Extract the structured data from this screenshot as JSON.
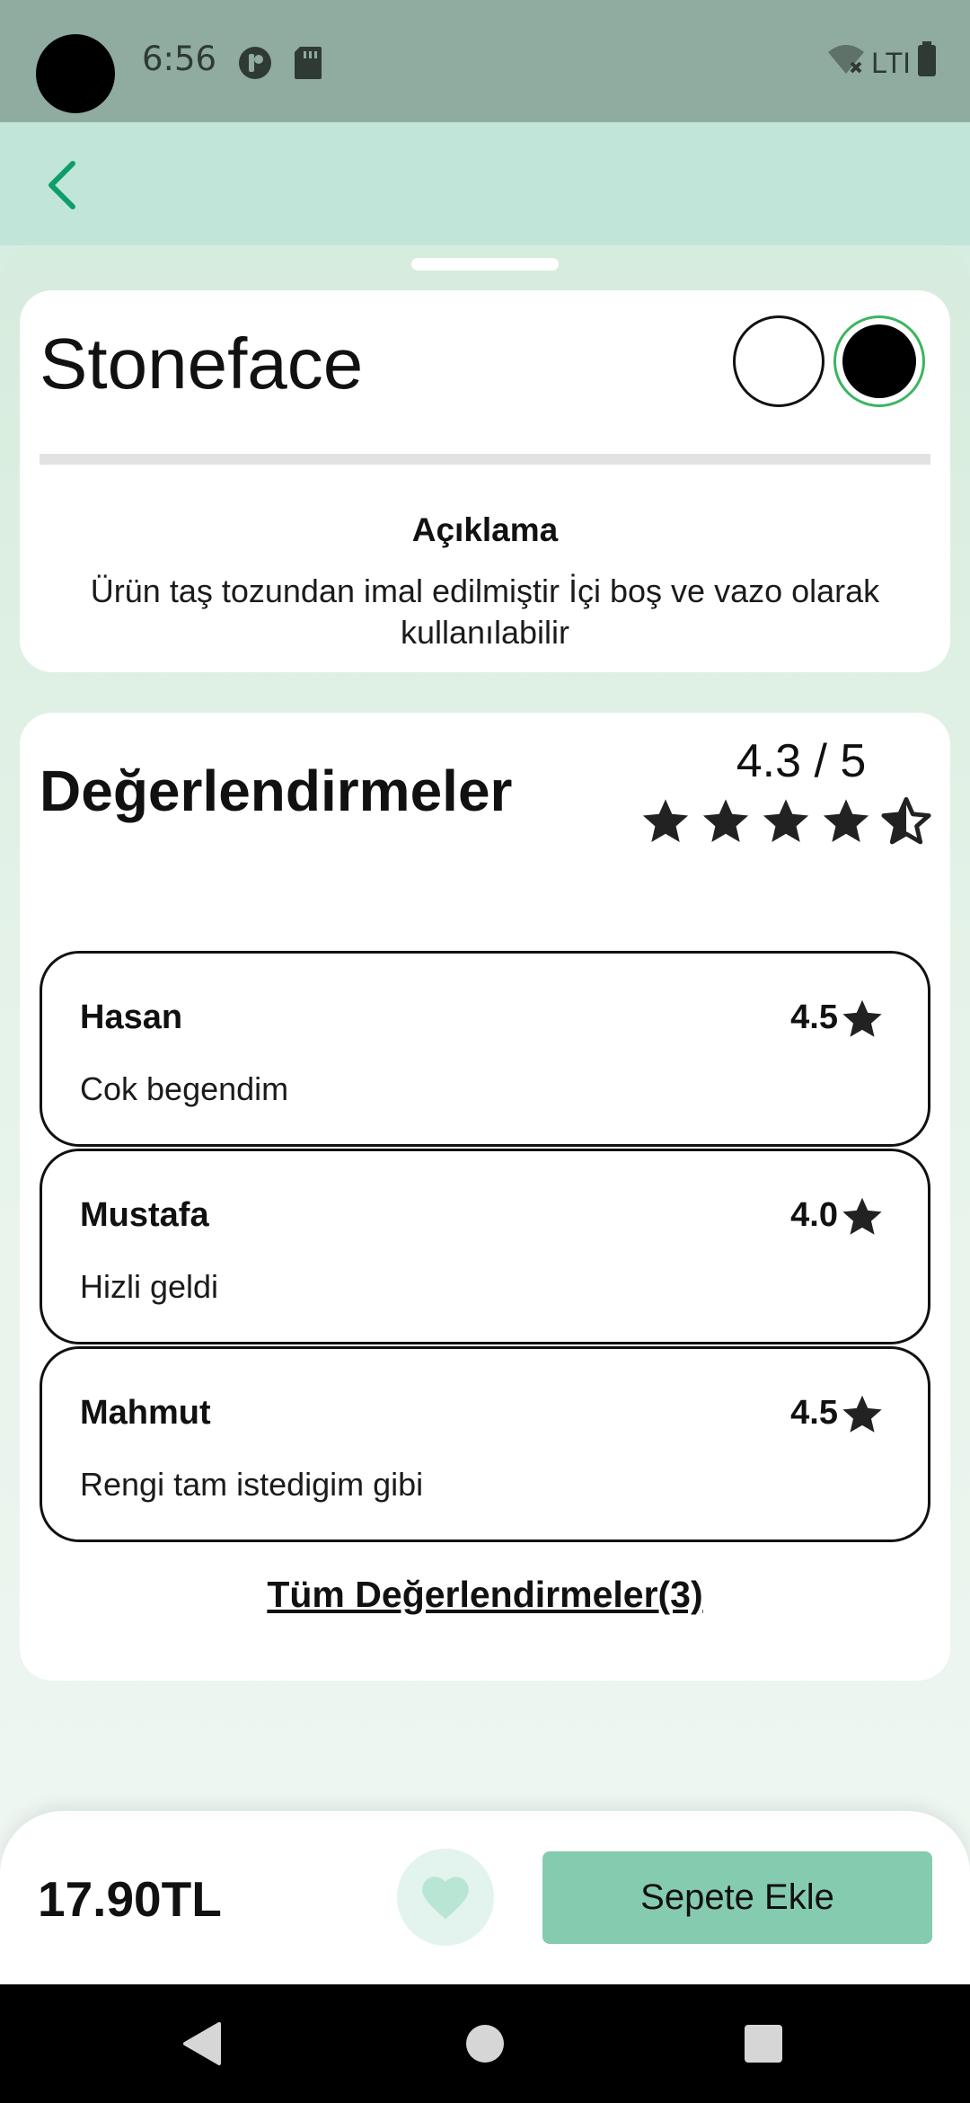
{
  "status_bar": {
    "time": "6:56",
    "network_label": "LTI"
  },
  "product": {
    "name": "Stoneface",
    "colors": [
      "#ffffff",
      "#000000"
    ],
    "selected_color": "#000000",
    "description_title": "Açıklama",
    "description": "Ürün taş tozundan imal edilmiştir İçi boş ve vazo olarak kullanılabilir"
  },
  "reviews": {
    "title": "Değerlendirmeler",
    "average": "4.3 / 5",
    "average_value": 4.3,
    "items": [
      {
        "name": "Hasan",
        "score": "4.5",
        "text": "Cok begendim"
      },
      {
        "name": "Mustafa",
        "score": "4.0",
        "text": "Hizli geldi"
      },
      {
        "name": "Mahmut",
        "score": "4.5",
        "text": "Rengi tam istedigim gibi"
      }
    ],
    "all_link": "Tüm Değerlendirmeler(3)"
  },
  "bottom_bar": {
    "price": "17.90TL",
    "add_to_cart": "Sepete Ekle"
  },
  "colors": {
    "accent": "#85cbb0",
    "app_bar": "#c2e5da",
    "status_bar": "#90aba0",
    "back_icon": "#0f9e6a",
    "selected_border": "#3bb55f"
  }
}
